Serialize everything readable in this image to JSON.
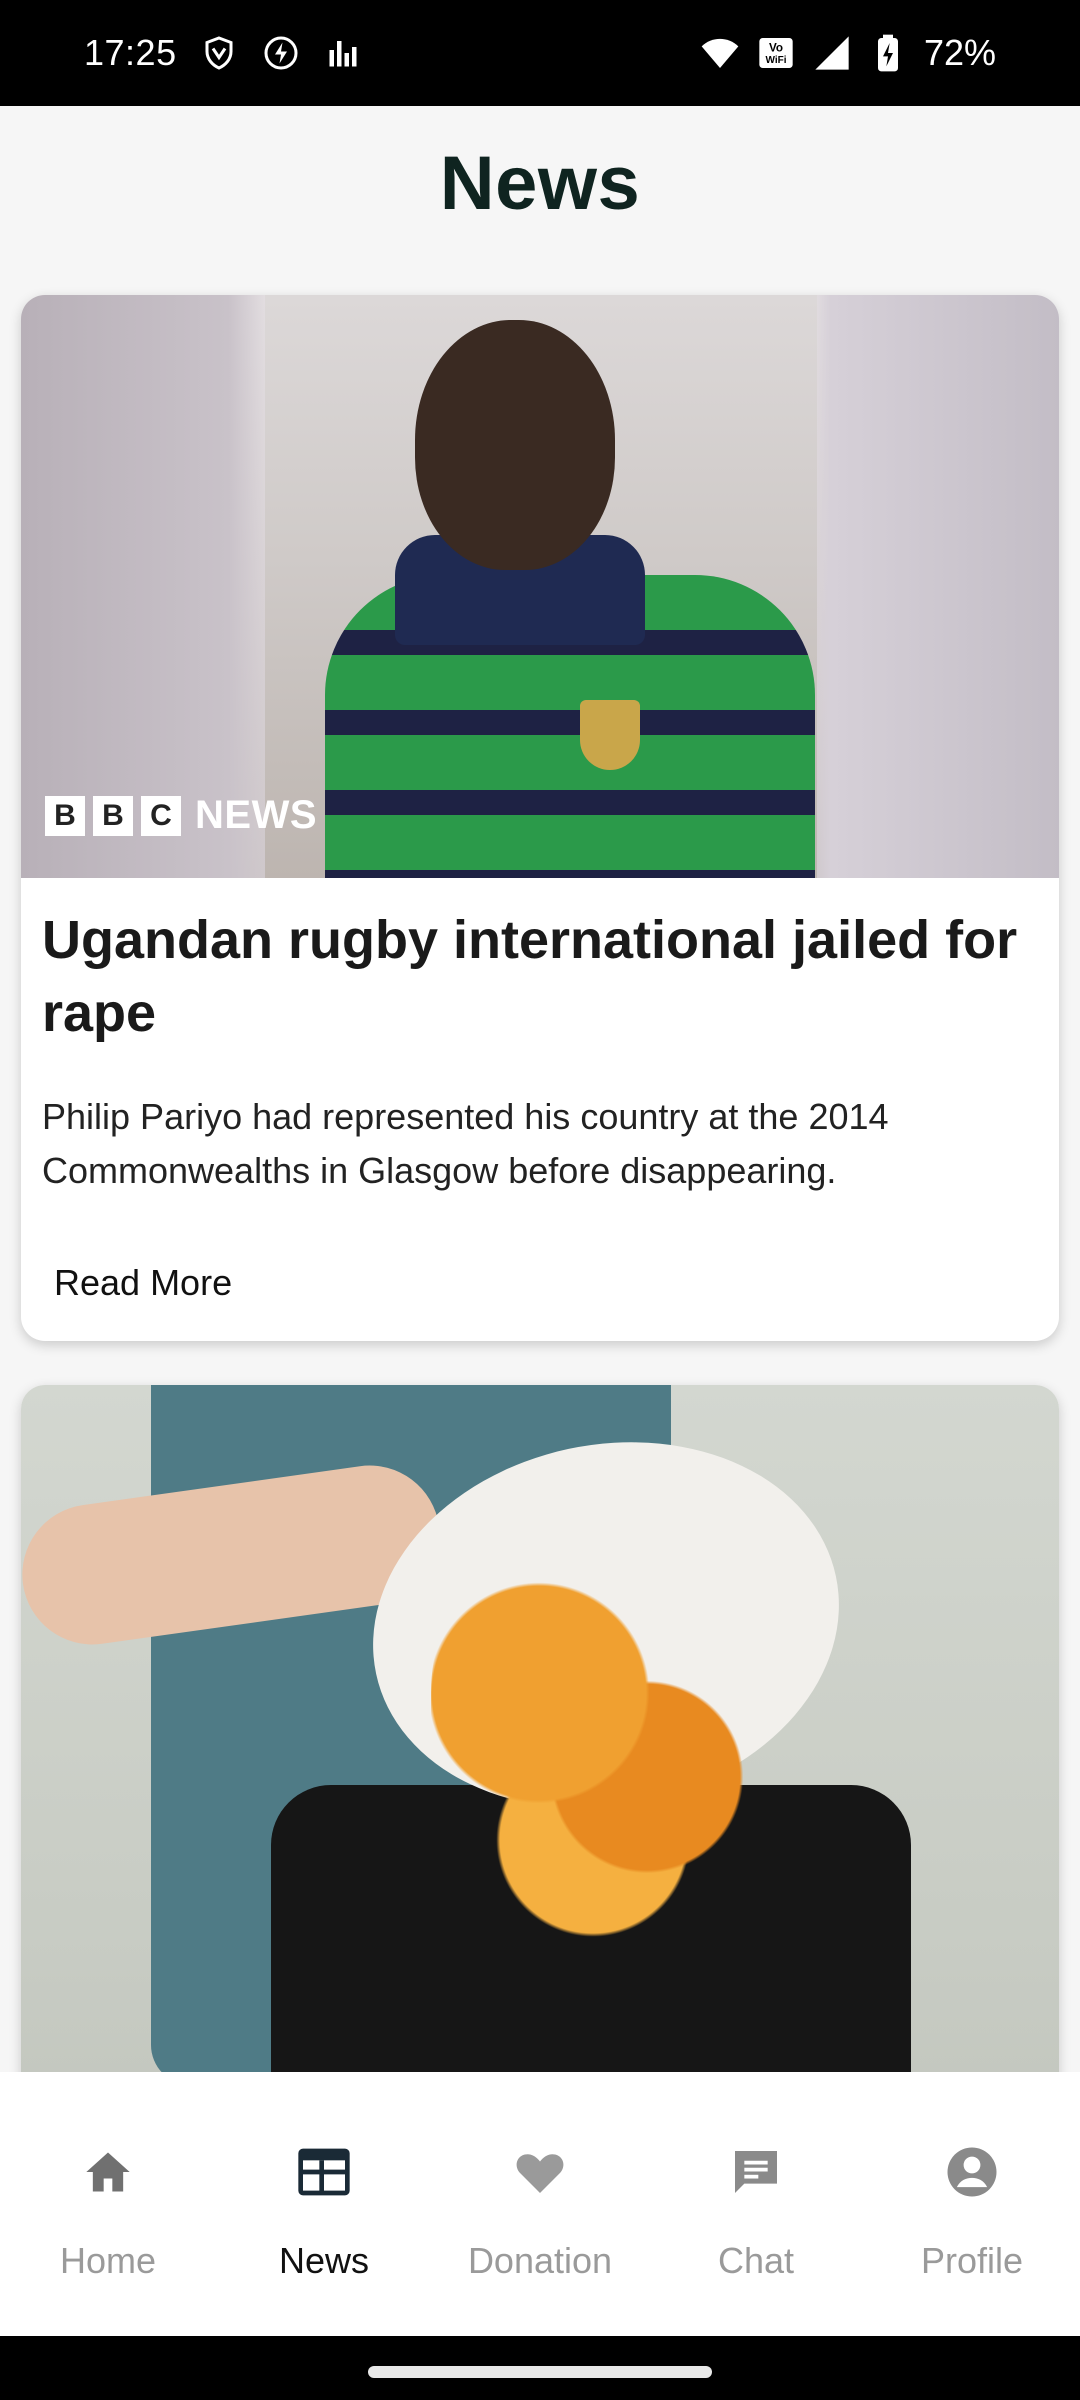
{
  "status_bar": {
    "time": "17:25",
    "battery": "72%",
    "icons_left": [
      "vpn-shield-icon",
      "bolt-icon",
      "signal-bars-icon"
    ],
    "icons_right": [
      "wifi-icon",
      "vowifi-icon",
      "cell-signal-icon",
      "battery-charging-icon"
    ]
  },
  "header": {
    "title": "News"
  },
  "articles": [
    {
      "title": "Ugandan rugby international jailed for rape",
      "description": "Philip Pariyo had represented his country at the 2014 Commonwealths in Glasgow before disappearing.",
      "read_more": "Read More",
      "logo": {
        "letters": [
          "B",
          "B",
          "C"
        ],
        "text": "NEWS"
      }
    },
    {
      "title": "",
      "description": "",
      "read_more": ""
    }
  ],
  "bottom_nav": {
    "items": [
      {
        "label": "Home",
        "icon": "home-icon",
        "active": false
      },
      {
        "label": "News",
        "icon": "news-icon",
        "active": true
      },
      {
        "label": "Donation",
        "icon": "heart-icon",
        "active": false
      },
      {
        "label": "Chat",
        "icon": "chat-icon",
        "active": false
      },
      {
        "label": "Profile",
        "icon": "profile-icon",
        "active": false
      }
    ]
  },
  "colors": {
    "title": "#0f2420",
    "nav_inactive": "#9a9a9a",
    "nav_active": "#111111",
    "background": "#f6f6f6"
  }
}
